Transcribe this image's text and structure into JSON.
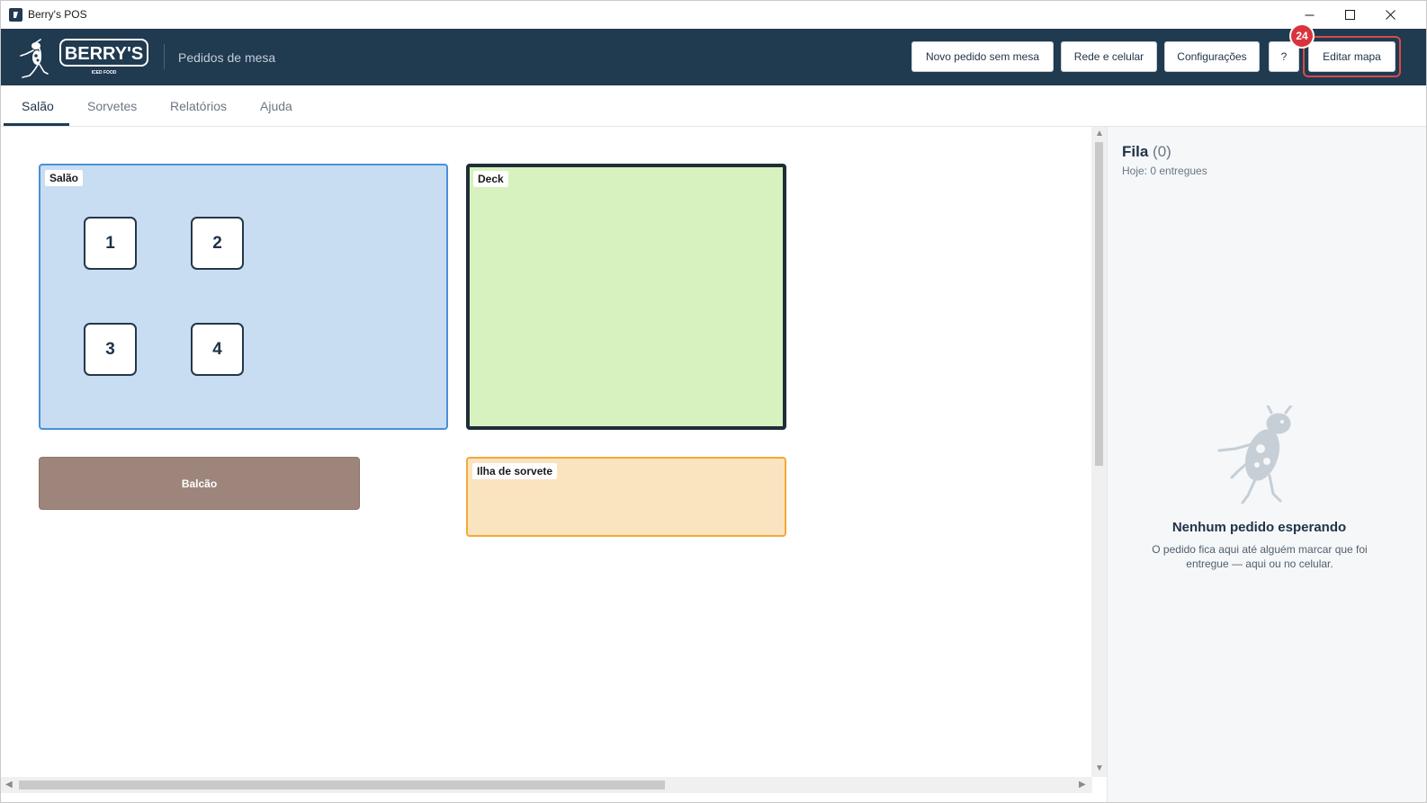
{
  "window": {
    "title": "Berry's POS"
  },
  "header": {
    "logo_text": "BERRY'S",
    "logo_subtext": "ICED FOOD",
    "title": "Pedidos de mesa",
    "buttons": {
      "new_order": "Novo pedido sem mesa",
      "network": "Rede e celular",
      "settings": "Configurações",
      "help": "?",
      "edit_map": "Editar mapa"
    },
    "badge_count": "24",
    "colors": {
      "header_bg": "#203a50",
      "highlight": "#d94a4a",
      "badge": "#d9343d"
    }
  },
  "tabs": [
    {
      "label": "Salão",
      "active": true
    },
    {
      "label": "Sorvetes",
      "active": false
    },
    {
      "label": "Relatórios",
      "active": false
    },
    {
      "label": "Ajuda",
      "active": false
    }
  ],
  "map": {
    "zones": {
      "salao": {
        "label": "Salão",
        "color": "#c8dcf2"
      },
      "deck": {
        "label": "Deck",
        "color": "#d7f2be"
      },
      "balcao": {
        "label": "Balcão",
        "color": "#9e857c"
      },
      "ilha": {
        "label": "Ilha de sorvete",
        "color": "#fae3bf"
      }
    },
    "tables": [
      "1",
      "2",
      "3",
      "4"
    ]
  },
  "queue": {
    "title": "Fila",
    "count": "(0)",
    "today": "Hoje: 0 entregues",
    "empty_title": "Nenhum pedido esperando",
    "empty_desc": "O pedido fica aqui até alguém marcar que foi entregue — aqui ou no celular."
  }
}
